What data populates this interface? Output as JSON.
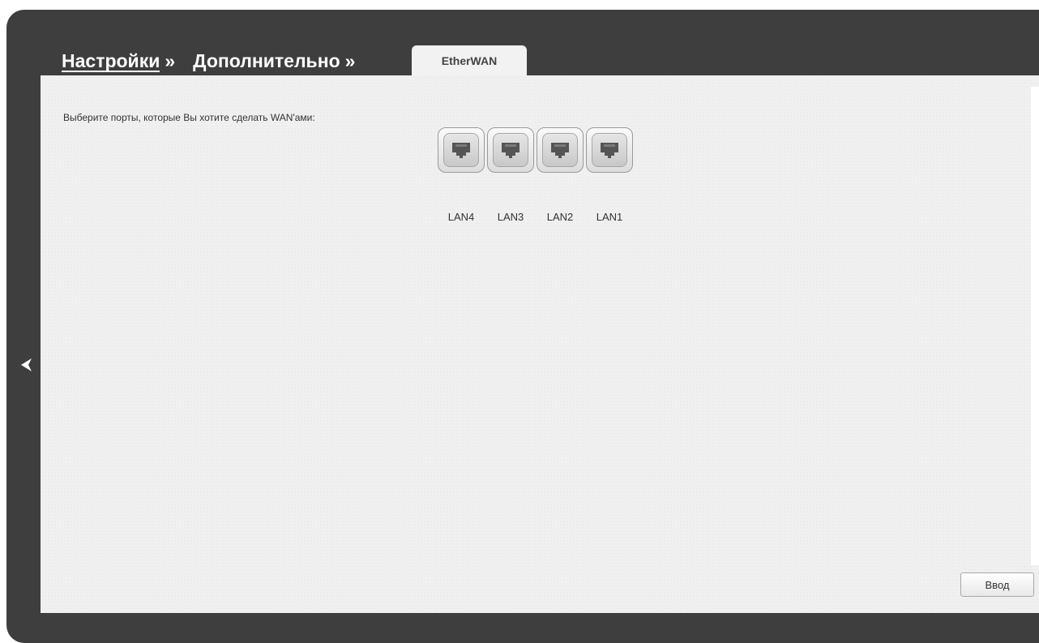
{
  "breadcrumb": {
    "settings": "Настройки",
    "sep1": "»",
    "advanced": "Дополнительно",
    "sep2": "»"
  },
  "tab": {
    "label": "EtherWAN"
  },
  "panel": {
    "prompt": "Выберите порты, которые Вы хотите сделать WAN'ами:"
  },
  "ports": [
    {
      "label": "LAN4",
      "selected": false
    },
    {
      "label": "LAN3",
      "selected": false
    },
    {
      "label": "LAN2",
      "selected": false
    },
    {
      "label": "LAN1",
      "selected": false
    }
  ],
  "submit_label": "Ввод",
  "icons": {
    "back": "chevron-left-icon",
    "port": "ethernet-port-icon"
  },
  "colors": {
    "frame": "#3e3e3e",
    "panel": "#f0f0f0",
    "text": "#333333"
  }
}
